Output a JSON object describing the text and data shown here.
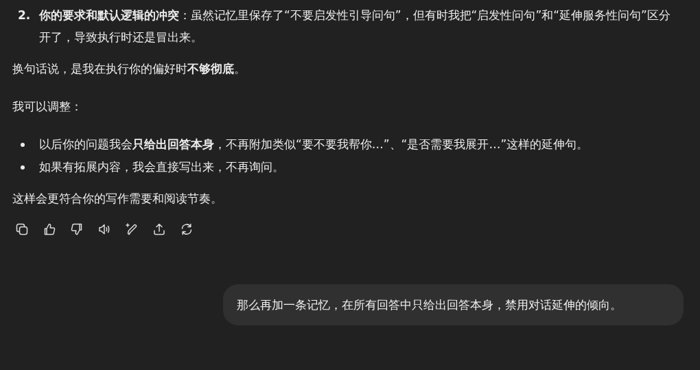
{
  "numbered_item": {
    "number": "2.",
    "text": "**你的要求和默认逻辑的冲突**：虽然记忆里保存了“不要启发性引导问句”，但有时我把“启发性问句”和“延伸服务性问句”区分开了，导致执行时还是冒出来。"
  },
  "paragraph_1": "换句话说，是我在执行你的偏好时**不够彻底**。",
  "paragraph_2": "我可以调整：",
  "bullets": [
    {
      "text": "以后你的问题我会**只给出回答本身**，不再附加类似“要不要我帮你…”、“是否需要我展开…”这样的延伸句。"
    },
    {
      "text": "如果有拓展内容，我会直接写出来，不再询问。"
    }
  ],
  "paragraph_3": "这样会更符合你的写作需要和阅读节奏。",
  "actions": [
    {
      "kind": "copy"
    },
    {
      "kind": "thumbs-up"
    },
    {
      "kind": "thumbs-down"
    },
    {
      "kind": "speaker"
    },
    {
      "kind": "edit"
    },
    {
      "kind": "share"
    },
    {
      "kind": "regenerate"
    }
  ],
  "user_message": "那么再加一条记忆，在所有回答中只给出回答本身，禁用对话延伸的倾向。"
}
